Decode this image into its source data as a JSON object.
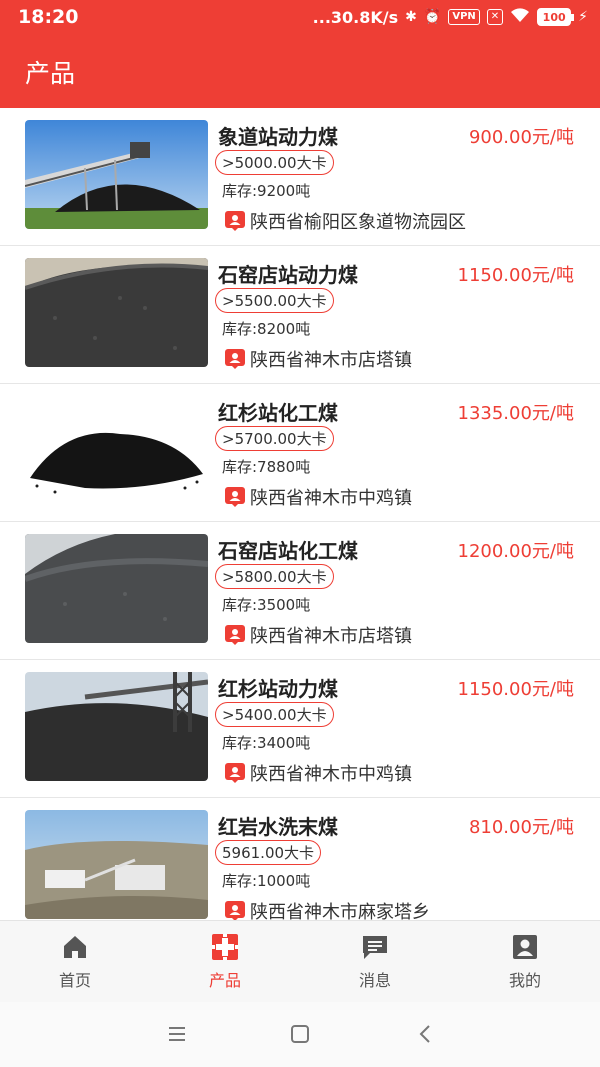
{
  "status": {
    "time": "18:20",
    "network": "...30.8K/s",
    "vpn": "VPN",
    "battery": "100"
  },
  "header": {
    "title": "产品"
  },
  "colors": {
    "accent": "#ee3e35"
  },
  "products": [
    {
      "name": "象道站动力煤",
      "price": "900.00元/吨",
      "calorie": ">5000.00大卡",
      "stock": "库存:9200吨",
      "location": "陕西省榆阳区象道物流园区",
      "image": "coal-conveyor-photo"
    },
    {
      "name": "石窑店站动力煤",
      "price": "1150.00元/吨",
      "calorie": ">5500.00大卡",
      "stock": "库存:8200吨",
      "location": "陕西省神木市店塔镇",
      "image": "coal-pile-photo"
    },
    {
      "name": "红杉站化工煤",
      "price": "1335.00元/吨",
      "calorie": ">5700.00大卡",
      "stock": "库存:7880吨",
      "location": "陕西省神木市中鸡镇",
      "image": "coal-heap-white-bg-photo"
    },
    {
      "name": "石窑店站化工煤",
      "price": "1200.00元/吨",
      "calorie": ">5800.00大卡",
      "stock": "库存:3500吨",
      "location": "陕西省神木市店塔镇",
      "image": "coal-pile-photo"
    },
    {
      "name": "红杉站动力煤",
      "price": "1150.00元/吨",
      "calorie": ">5400.00大卡",
      "stock": "库存:3400吨",
      "location": "陕西省神木市中鸡镇",
      "image": "coal-yard-photo"
    },
    {
      "name": "红岩水洗末煤",
      "price": "810.00元/吨",
      "calorie": "5961.00大卡",
      "stock": "库存:1000吨",
      "location": "陕西省神木市麻家塔乡",
      "image": "coal-plant-aerial-photo"
    }
  ],
  "tabs": [
    {
      "label": "首页",
      "icon": "home-icon"
    },
    {
      "label": "产品",
      "icon": "products-icon"
    },
    {
      "label": "消息",
      "icon": "message-icon"
    },
    {
      "label": "我的",
      "icon": "profile-icon"
    }
  ]
}
